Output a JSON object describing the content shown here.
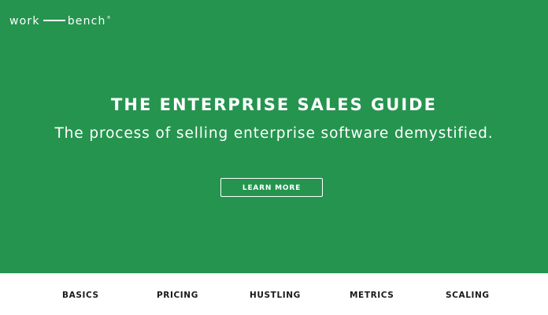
{
  "logo": {
    "left_word": "work",
    "right_word": "bench",
    "mark": "®"
  },
  "hero": {
    "title": "THE ENTERPRISE SALES GUIDE",
    "subtitle": "The process of selling enterprise software demystified.",
    "cta_label": "LEARN MORE",
    "background_color": "#25944f",
    "text_color": "#ffffff"
  },
  "nav": {
    "items": [
      {
        "label": "BASICS"
      },
      {
        "label": "PRICING"
      },
      {
        "label": "HUSTLING"
      },
      {
        "label": "METRICS"
      },
      {
        "label": "SCALING"
      }
    ]
  }
}
